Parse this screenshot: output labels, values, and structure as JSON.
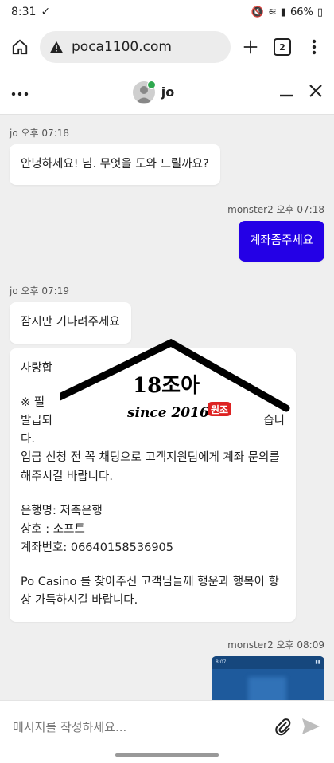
{
  "status_bar": {
    "time": "8:31",
    "battery": "66%"
  },
  "browser": {
    "url": "poca1100.com",
    "tab_count": "2"
  },
  "chat_header": {
    "agent_name": "jo"
  },
  "messages": [
    {
      "sender": "jo",
      "time_label": "jo 오후 07:18",
      "text": "안녕하세요! 님. 무엇을 도와 드릴까요?"
    },
    {
      "sender": "monster2",
      "time_label": "monster2 오후 07:18",
      "text": "계좌좀주세요"
    },
    {
      "sender": "jo",
      "time_label": "jo 오후 07:19",
      "text": "잠시만 기다려주세요"
    },
    {
      "sender": "jo",
      "lines": {
        "greeting": "사랑합",
        "notice": "※ 필",
        "issue_1": "발급되",
        "issue_tail": "습니",
        "issue_2": "다.",
        "inquiry": "입금 신청 전 꼭 채팅으로 고객지원팀에게 계좌 문의를 해주시길 바랍니다.",
        "bank": "은행명: 저축은행",
        "company": "상호 : 소프트",
        "account": "계좌번호: 06640158536905",
        "closing": "Po Casino 를 찾아주신 고객님들께 행운과 행복이 항상 가득하시길 바랍니다."
      }
    },
    {
      "sender": "monster2",
      "time_label": "monster2 오후 08:09",
      "image_time": "8:07"
    }
  ],
  "input": {
    "placeholder": "메시지를 작성하세요..."
  },
  "watermark": {
    "brand": "18조아",
    "since": "since 2016",
    "badge": "원조"
  }
}
